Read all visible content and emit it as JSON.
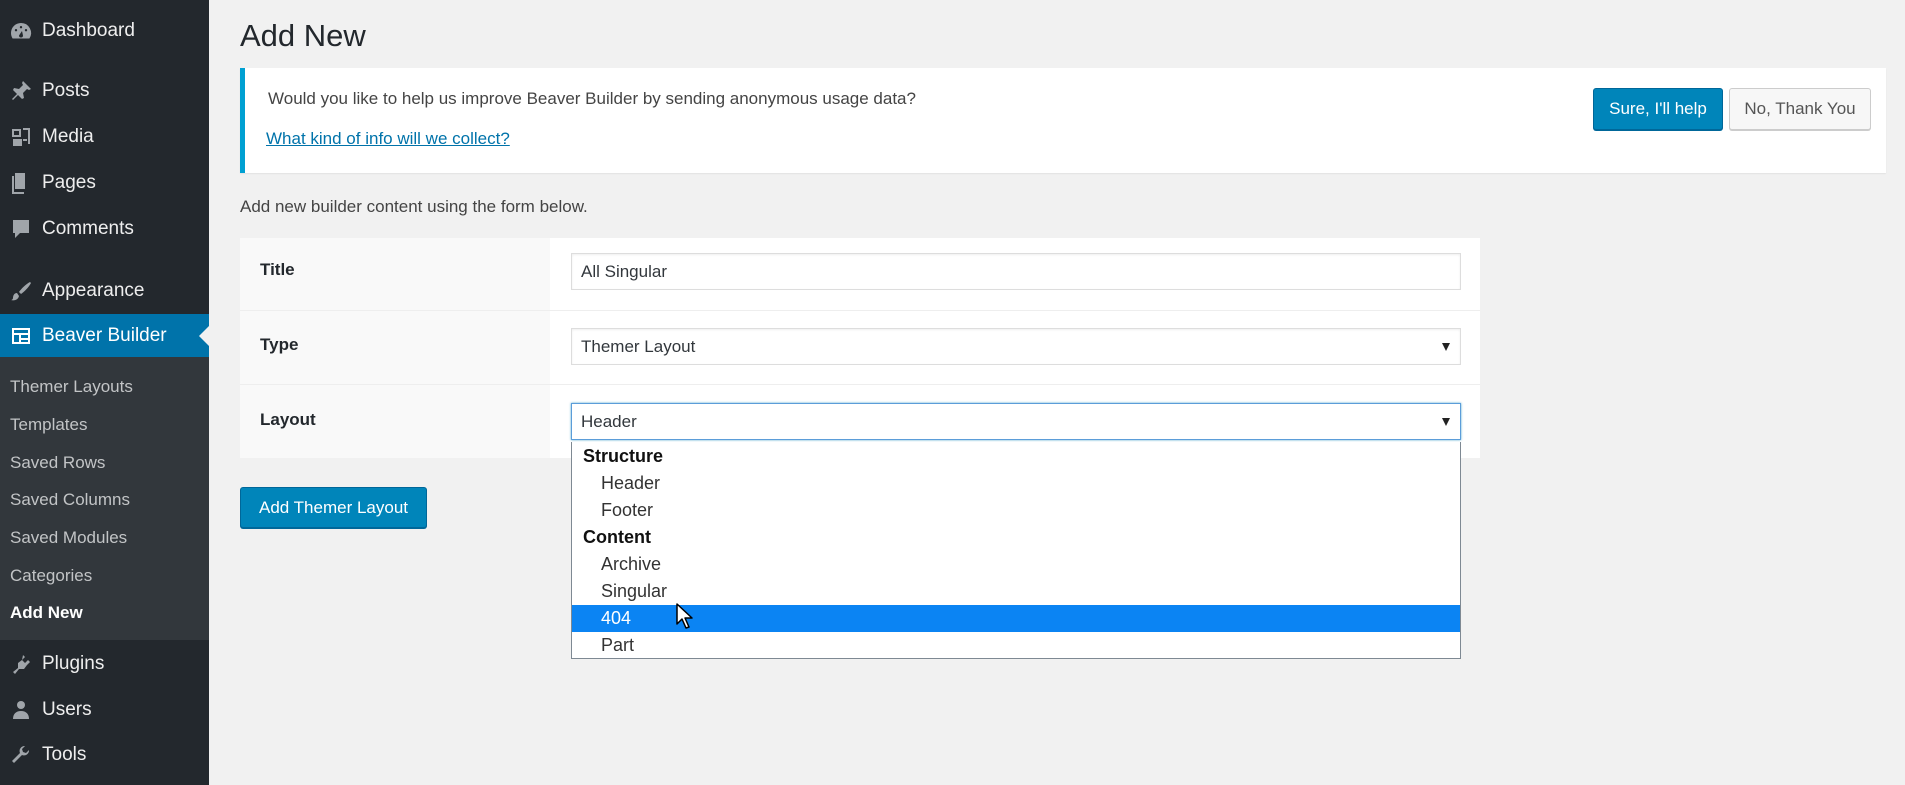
{
  "sidebar": {
    "menu": [
      {
        "label": "Dashboard",
        "icon": "dashboard-icon"
      },
      {
        "label": "Posts",
        "icon": "pushpin-icon"
      },
      {
        "label": "Media",
        "icon": "media-icon"
      },
      {
        "label": "Pages",
        "icon": "pages-icon"
      },
      {
        "label": "Comments",
        "icon": "comment-icon"
      },
      {
        "label": "Appearance",
        "icon": "paintbrush-icon"
      },
      {
        "label": "Beaver Builder",
        "icon": "layout-icon"
      },
      {
        "label": "Plugins",
        "icon": "plugin-icon"
      },
      {
        "label": "Users",
        "icon": "user-icon"
      },
      {
        "label": "Tools",
        "icon": "wrench-icon"
      }
    ],
    "submenu": [
      {
        "label": "Themer Layouts"
      },
      {
        "label": "Templates"
      },
      {
        "label": "Saved Rows"
      },
      {
        "label": "Saved Columns"
      },
      {
        "label": "Saved Modules"
      },
      {
        "label": "Categories"
      },
      {
        "label": "Add New"
      }
    ]
  },
  "page": {
    "title": "Add New",
    "intro": "Add new builder content using the form below.",
    "submit_label": "Add Themer Layout"
  },
  "notice": {
    "text": "Would you like to help us improve Beaver Builder by sending anonymous usage data?",
    "link": "What kind of info will we collect?",
    "accept_label": "Sure, I'll help",
    "decline_label": "No, Thank You"
  },
  "form": {
    "title_label": "Title",
    "title_value": "All Singular",
    "type_label": "Type",
    "type_value": "Themer Layout",
    "layout_label": "Layout",
    "layout_value": "Header"
  },
  "dropdown": {
    "groups": [
      {
        "label": "Structure",
        "options": [
          "Header",
          "Footer"
        ]
      },
      {
        "label": "Content",
        "options": [
          "Archive",
          "Singular",
          "404",
          "Part"
        ]
      }
    ],
    "highlighted": "404"
  },
  "colors": {
    "sidebar_bg": "#23282d",
    "submenu_bg": "#32373c",
    "accent": "#0073aa",
    "button_primary": "#0085ba",
    "notice_border": "#00a0d2",
    "highlight": "#0b84f3"
  }
}
